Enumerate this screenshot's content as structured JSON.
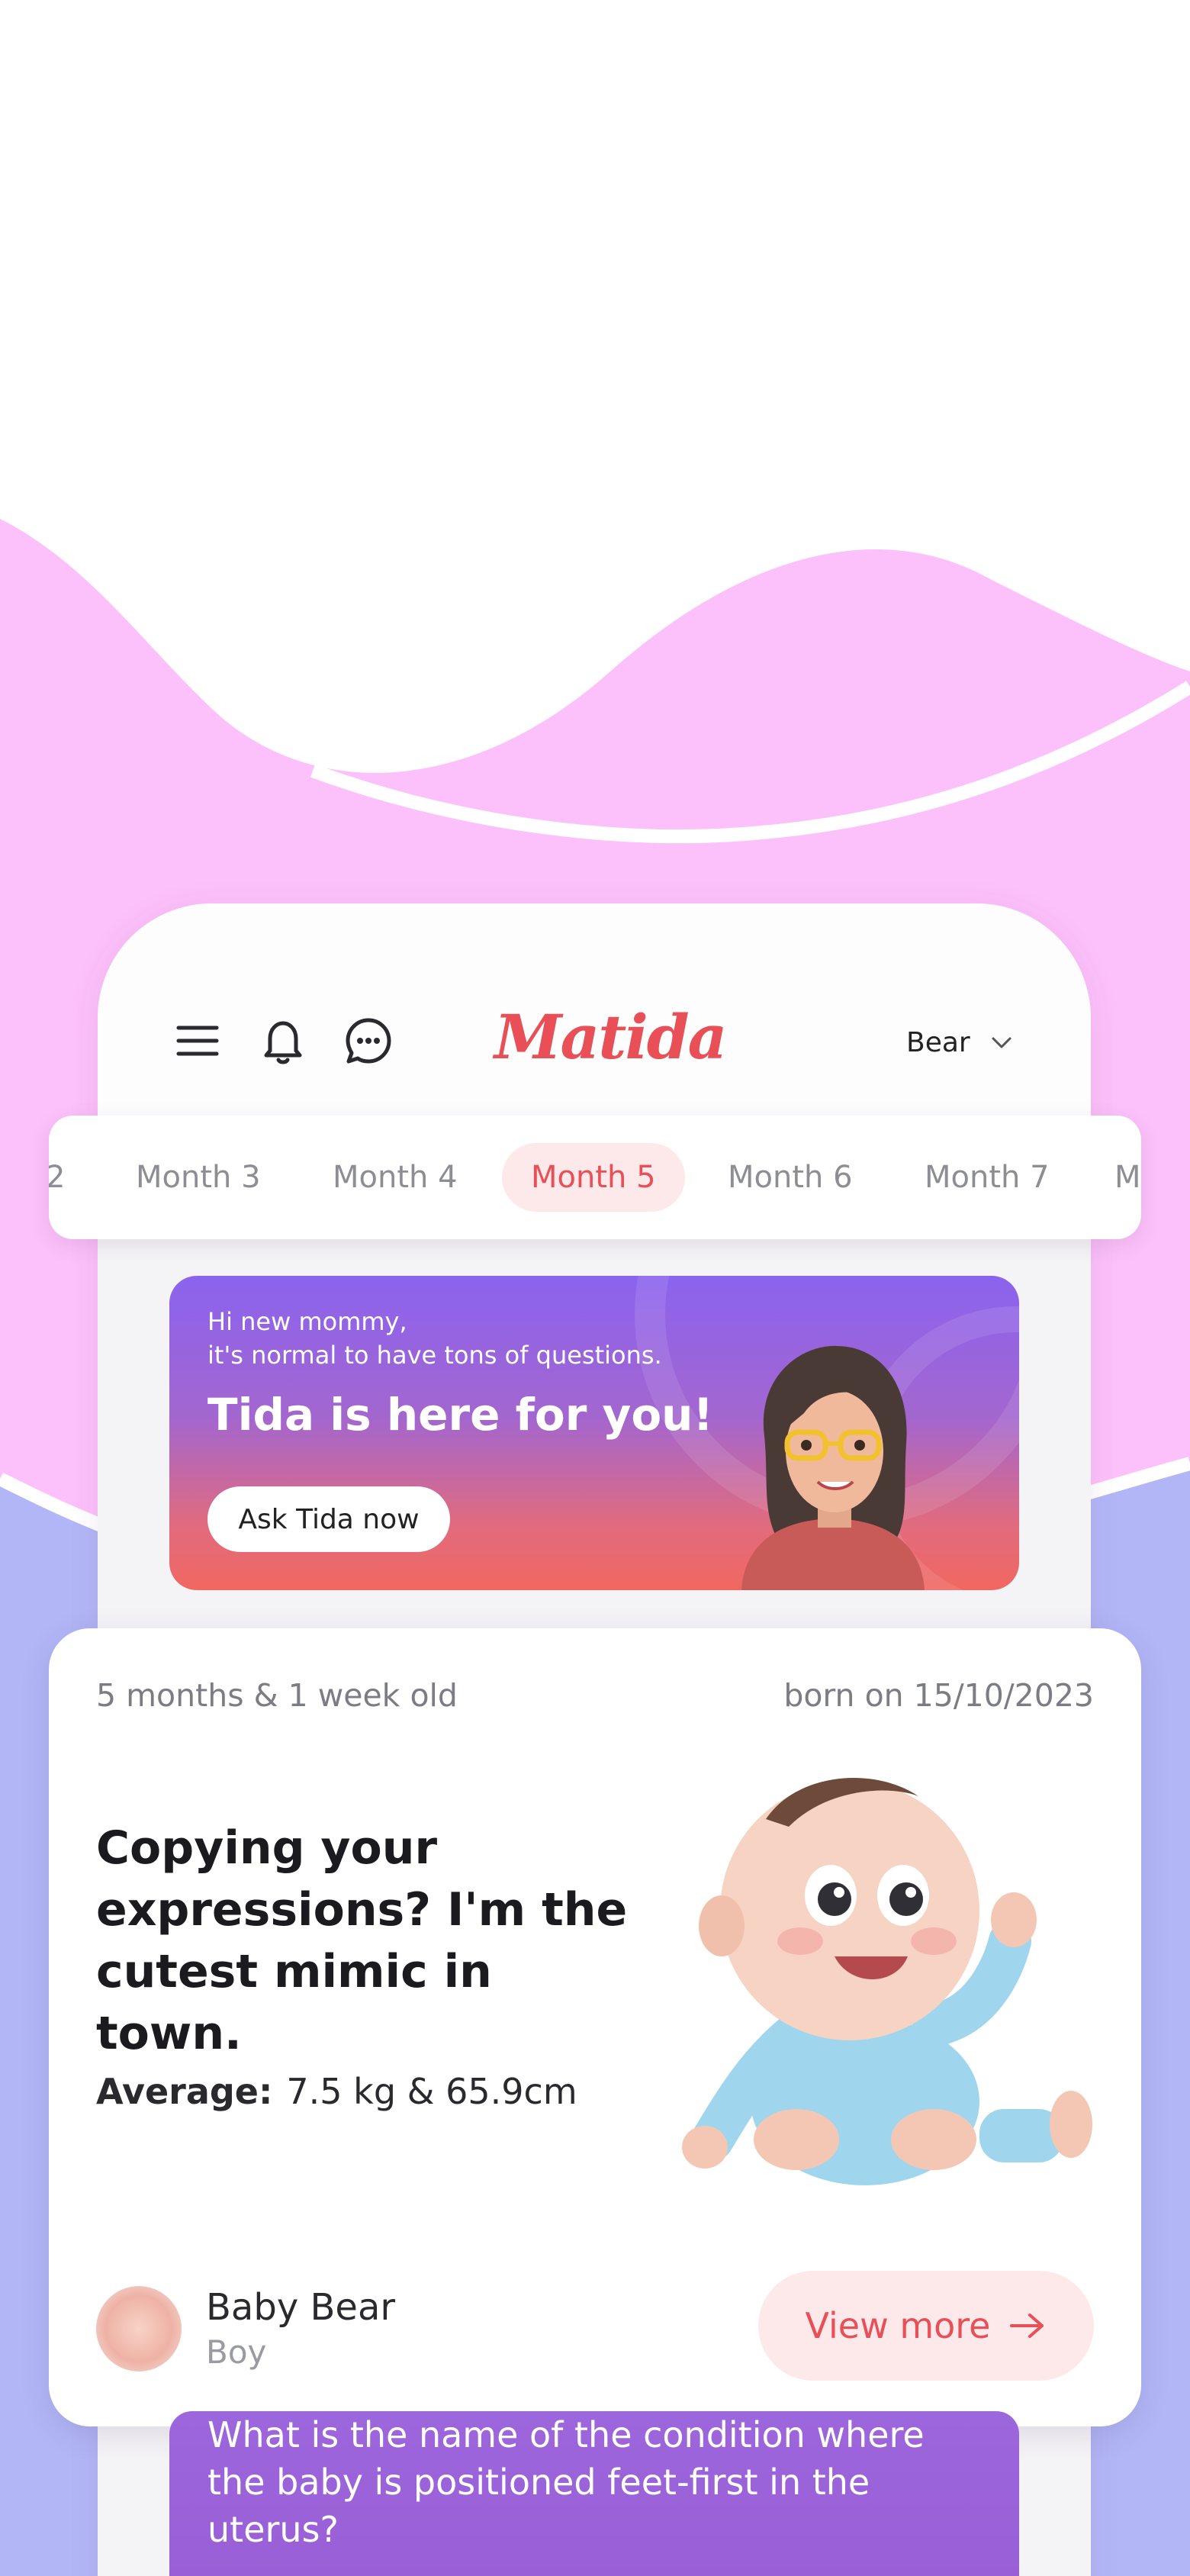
{
  "colors": {
    "brand": "#e84f57",
    "wave_pink": "#fcc0fa",
    "wave_lavender": "#b2b6f6",
    "banner_top": "#8b63ee",
    "banner_bottom": "#f16761",
    "active_pill_bg": "#fde8ea"
  },
  "header": {
    "menu_icon": "hamburger-menu-icon",
    "bell_icon": "bell-icon",
    "chat_icon": "chat-bubble-icon",
    "logo": "Matida",
    "profile_name": "Bear"
  },
  "month_tabs": {
    "items": [
      {
        "label": "2",
        "active": false
      },
      {
        "label": "Month 3",
        "active": false
      },
      {
        "label": "Month 4",
        "active": false
      },
      {
        "label": "Month 5",
        "active": true
      },
      {
        "label": "Month 6",
        "active": false
      },
      {
        "label": "Month 7",
        "active": false
      },
      {
        "label": "M",
        "active": false
      }
    ]
  },
  "tida_banner": {
    "greeting_line1": "Hi new mommy,",
    "greeting_line2": "it's normal to have tons of questions.",
    "title": "Tida is here for you!",
    "button": "Ask Tida now",
    "avatar": "tida-assistant-avatar"
  },
  "baby_card": {
    "age": "5 months & 1 week old",
    "born": "born on 15/10/2023",
    "headline": "Copying your expressions? I'm the cutest mimic in town.",
    "average_label": "Average:",
    "average_value": "7.5 kg & 65.9cm",
    "baby_name": "Baby Bear",
    "baby_gender": "Boy",
    "view_more": "View more",
    "illustration": "baby-3d-illustration"
  },
  "question_card": {
    "text": "What is the name of the condition where the baby is positioned feet-first in the uterus?"
  }
}
